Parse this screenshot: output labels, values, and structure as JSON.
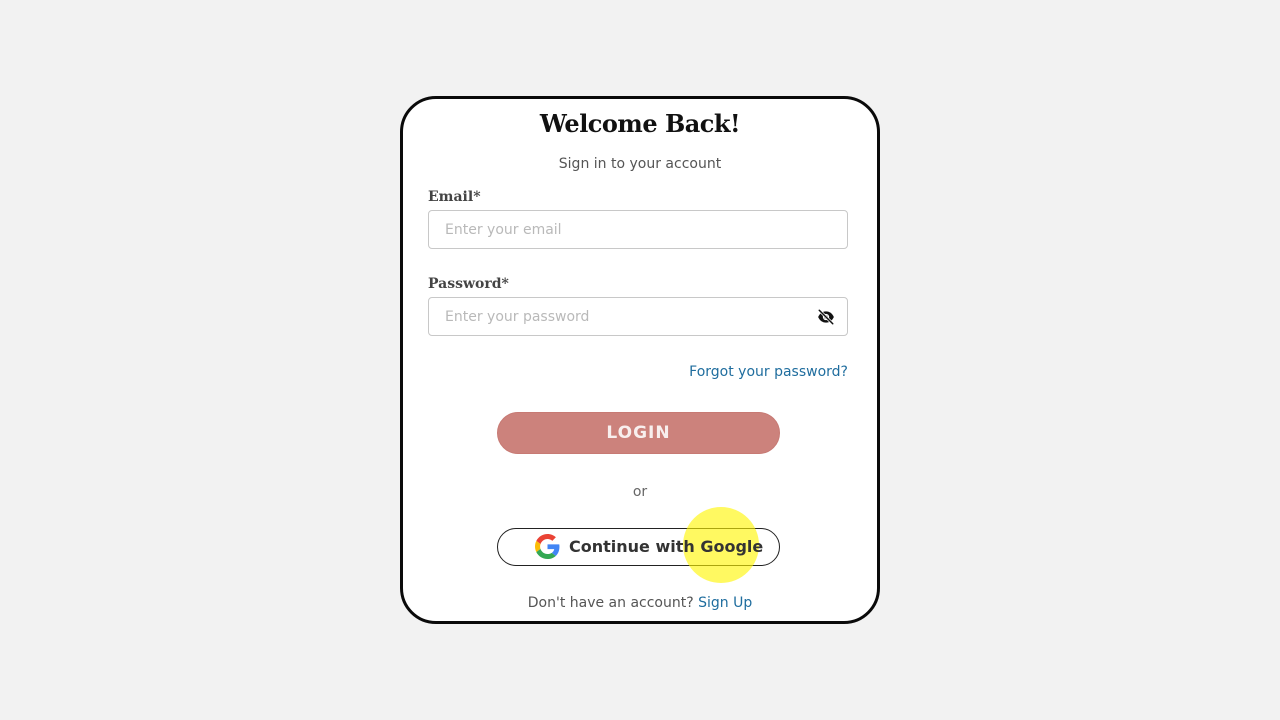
{
  "header": {
    "title": "Welcome Back!",
    "subtitle": "Sign in to your account"
  },
  "form": {
    "email": {
      "label": "Email*",
      "placeholder": "Enter your email",
      "value": ""
    },
    "password": {
      "label": "Password*",
      "placeholder": "Enter your password",
      "value": "",
      "toggle_icon": "eye-off-icon"
    },
    "forgot_link": "Forgot your password?",
    "login_label": "LOGIN",
    "divider_text": "or",
    "google_label": "Continue with Google",
    "google_icon": "google-icon"
  },
  "footer": {
    "prompt": "Don't have an account?",
    "signup_label": "Sign Up"
  },
  "colors": {
    "background": "#f2f2f2",
    "card_border": "#0a0a0a",
    "login_button": "#cc827c",
    "link": "#1f6d9e",
    "click_highlight": "#fff500"
  }
}
